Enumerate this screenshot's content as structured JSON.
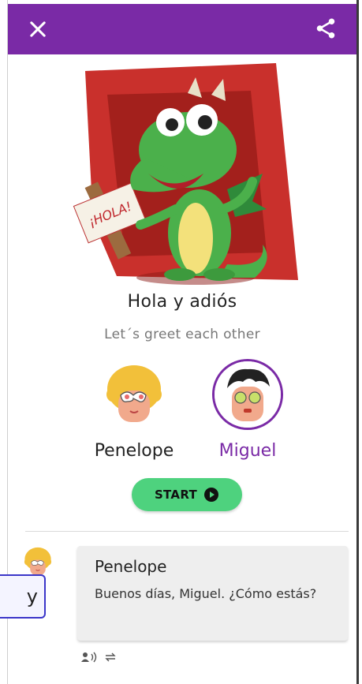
{
  "header": {
    "close_icon": "close-icon",
    "share_icon": "share-icon",
    "color": "#7a2aa6"
  },
  "lesson": {
    "hero_badge_text": "¡HOLA!",
    "title": "Hola y adiós",
    "subtitle": "Let´s greet each other"
  },
  "characters": [
    {
      "name": "Penelope",
      "selected": false
    },
    {
      "name": "Miguel",
      "selected": true
    }
  ],
  "start_button": {
    "label": "START",
    "icon": "play-circle-icon",
    "color": "#4ed27e"
  },
  "dialogue": {
    "speaker": "Penelope",
    "line": "Buenos días, Miguel. ¿Cómo estás?",
    "tools": [
      "speaker-icon",
      "swap-icon"
    ]
  },
  "overlay": {
    "text": "y"
  }
}
